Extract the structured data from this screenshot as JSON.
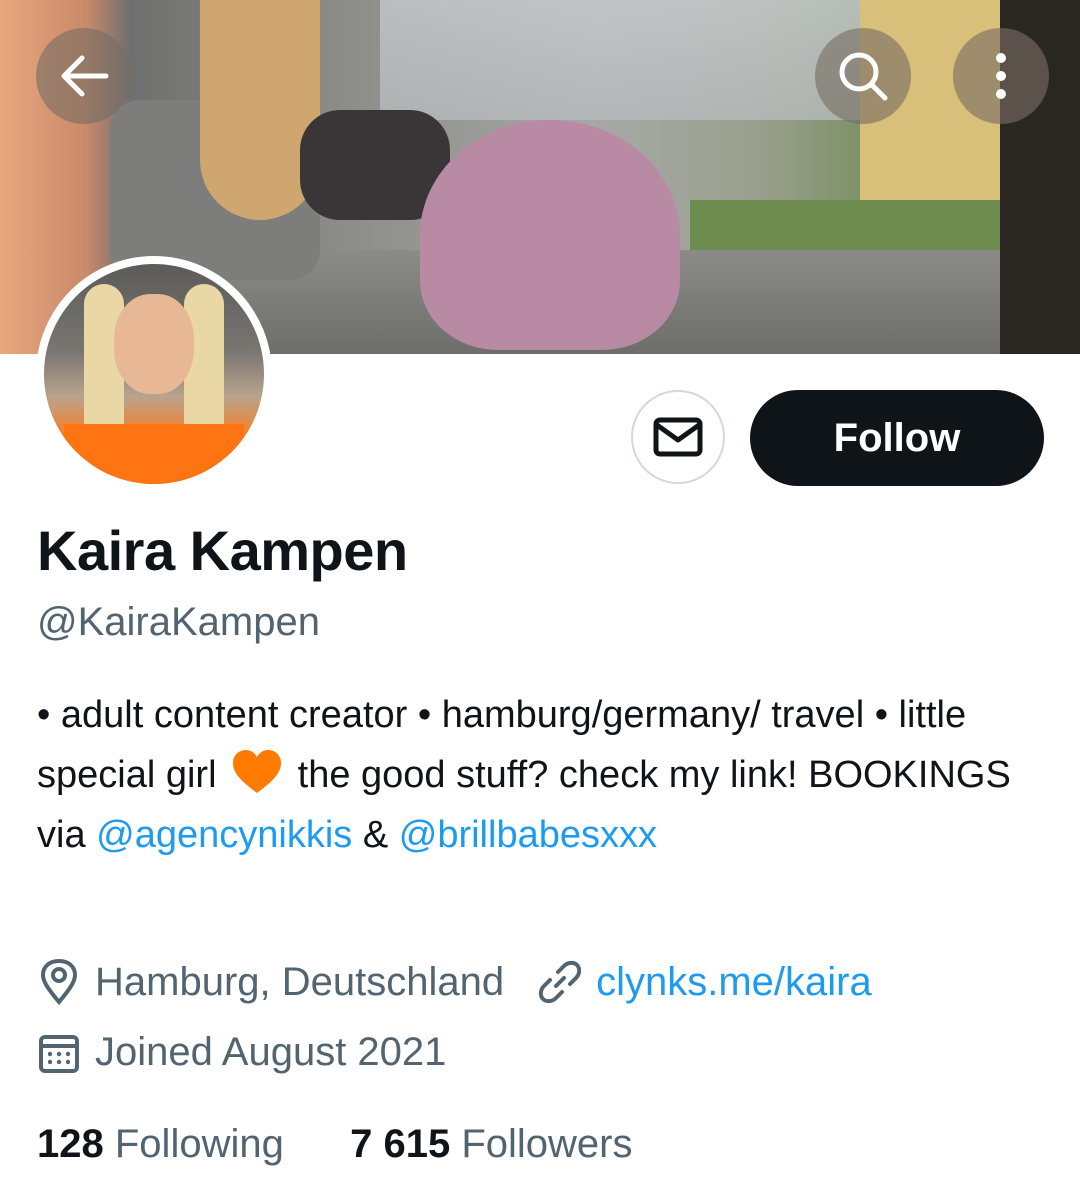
{
  "header": {
    "back_icon": "arrow-left-icon",
    "search_icon": "search-icon",
    "more_icon": "more-vertical-icon"
  },
  "profile": {
    "display_name": "Kaira Kampen",
    "handle": "@KairaKampen",
    "follow_label": "Follow",
    "message_icon": "envelope-icon",
    "bio": {
      "part1": "• adult content creator • hamburg/germany/ travel • little special girl ",
      "emoji": "orange-heart",
      "part2": " the good stuff? check my link! BOOKINGS via ",
      "mention1": "@agencynikkis",
      "part3": " & ",
      "mention2": "@brillbabesxxx"
    },
    "location": "Hamburg, Deutschland",
    "website": "clynks.me/kaira",
    "joined": "Joined August 2021",
    "following_count": "128",
    "following_label": "Following",
    "followers_count": "7 615",
    "followers_label": "Followers"
  },
  "colors": {
    "accent": "#1d9bf0",
    "text_primary": "#0f1419",
    "text_secondary": "#536471",
    "follow_bg": "#0f1419"
  }
}
